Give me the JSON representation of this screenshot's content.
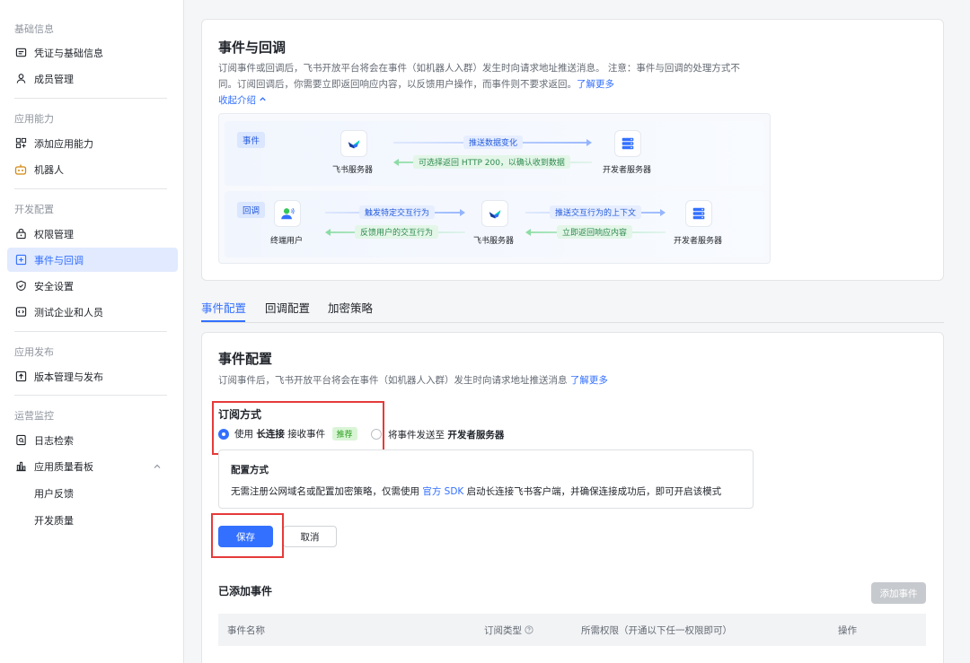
{
  "sidebar": {
    "groups": [
      {
        "title": "基础信息"
      },
      {
        "title": "应用能力"
      },
      {
        "title": "开发配置"
      },
      {
        "title": "应用发布"
      },
      {
        "title": "运营监控"
      }
    ],
    "items": [
      {
        "label": "凭证与基础信息"
      },
      {
        "label": "成员管理"
      },
      {
        "label": "添加应用能力"
      },
      {
        "label": "机器人"
      },
      {
        "label": "权限管理"
      },
      {
        "label": "事件与回调"
      },
      {
        "label": "安全设置"
      },
      {
        "label": "测试企业和人员"
      },
      {
        "label": "版本管理与发布"
      },
      {
        "label": "日志检索"
      },
      {
        "label": "应用质量看板"
      }
    ],
    "sub_items": [
      {
        "label": "用户反馈"
      },
      {
        "label": "开发质量"
      }
    ]
  },
  "intro": {
    "title": "事件与回调",
    "desc_line1": "订阅事件或回调后，飞书开放平台将会在事件（如机器人入群）发生时向请求地址推送消息。 注意：事件与回调的处理方式不",
    "desc_line2": "同。订阅回调后，你需要立即返回响应内容，以反馈用户操作，而事件则不要求返回。",
    "learn_more": "了解更多",
    "collapse": "收起介绍"
  },
  "diagram": {
    "event_tag": "事件",
    "callback_tag": "回调",
    "feishu_server": "飞书服务器",
    "dev_server": "开发者服务器",
    "terminal_user": "终端用户",
    "push_data": "推送数据变化",
    "optional_return": "可选择返回 HTTP 200，以确认收到数据",
    "trigger": "触发特定交互行为",
    "feedback": "反馈用户的交互行为",
    "push_context": "推送交互行为的上下文",
    "return_now": "立即返回响应内容"
  },
  "tabs": [
    {
      "label": "事件配置"
    },
    {
      "label": "回调配置"
    },
    {
      "label": "加密策略"
    }
  ],
  "event_config": {
    "title": "事件配置",
    "desc": "订阅事件后，飞书开放平台将会在事件（如机器人入群）发生时向请求地址推送消息",
    "learn_more": "了解更多",
    "subscribe_title": "订阅方式",
    "opt1_pre": "使用",
    "opt1_bold": "长连接",
    "opt1_post": "接收事件",
    "opt1_badge": "推荐",
    "opt2_pre": "将事件发送至",
    "opt2_bold": "开发者服务器",
    "mode_title": "配置方式",
    "mode_desc_pre": "无需注册公网域名或配置加密策略，仅需使用",
    "mode_desc_link": "官方 SDK",
    "mode_desc_post": "启动长连接飞书客户端，并确保连接成功后，即可开启该模式",
    "save": "保存",
    "cancel": "取消",
    "added_title": "已添加事件",
    "add_event": "添加事件",
    "columns": [
      "事件名称",
      "订阅类型",
      "所需权限（开通以下任一权限即可）",
      "操作"
    ]
  },
  "colors": {
    "accent": "#3370ff",
    "highlight_box": "#e63a3a"
  }
}
